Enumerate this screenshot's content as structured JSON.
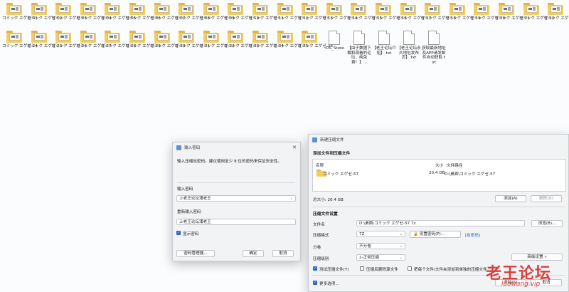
{
  "desktop": {
    "row1": [
      "コミック エゲゼ 01",
      "コミック エゲゼ 02",
      "コミック エゲゼ 03",
      "コミック エゲゼ 04",
      "コミック エゲゼ 05",
      "コミック エゲゼ 06",
      "コミック エゲゼ 07",
      "コミック エゲゼ 08",
      "コミック エゲゼ 09",
      "コミック エゲゼ 10",
      "コミック エゲゼ 11",
      "コミック エゲゼ 12",
      "コミック エゲゼ 13",
      "コミック エゲゼ 14",
      "コミック エゲゼ 15",
      "コミック エゲゼ 16",
      "コミック エゲゼ 17",
      "コミック エゲゼ 18",
      "コミック エゲゼ 19",
      "コミック エゲゼ 20",
      "コミック エゲゼ 21",
      "コミック エゲゼ 22",
      "コミック エゲゼ 23"
    ],
    "row2_folders": [
      "コミック エゲゼ 24",
      "コミック エゲゼ 25",
      "コミック エゲゼ 26",
      "コミック エゲゼ 27",
      "コミック エゲゼ 28",
      "コミック エゲゼ 29",
      "コミック エゲゼ 30",
      "コミック エゲゼ 31",
      "コミック エゲゼ 32",
      "コミック エゲゼ 33",
      "コミック エゲゼ 34",
      "コミック エゲゼ 35",
      "コミック エゲゼ 36"
    ],
    "row2_files": [
      ".DS_Store",
      "【由于数据下载和观看的论坛，纯免费！】...",
      "【老王论坛介绍】.txt",
      "【老王论坛永久地址发布页】.txt",
      "获取最新地址及APP请发邮件自动获取.txt"
    ]
  },
  "password_dialog": {
    "title": "输入密码",
    "hint": "输入压缩包密码。建议使用至少 8 位的密码来保证安全性。",
    "label_password": "输入密码",
    "password_value": "上老王论坛涌老王",
    "label_confirm": "重新输入密码",
    "confirm_value": "上老王论坛涌老王",
    "show_password": "显示密码",
    "btn_manager": "密码管理器...",
    "btn_ok": "确定",
    "btn_cancel": "取消",
    "close": "✕"
  },
  "archive_dialog": {
    "title": "新建压缩文件",
    "section_add": "添加文件到压缩文件",
    "col_name": "名称",
    "col_size": "大小",
    "col_path": "文件路径",
    "row_name": "コミック エゲゼ-57",
    "row_size": "20.4 GB",
    "row_path": "D:\\桌面\\コミック エゲゼ-57",
    "total": "总大小: 20.4 GB",
    "btn_add": "添加(A)",
    "btn_delete": "删除(D)",
    "section_settings": "压缩文件设置",
    "label_filename": "文件名",
    "filename_value": "D:\\桌面\\コミック エゲゼ-57.7z",
    "btn_browse": "浏览(B)...",
    "label_format": "压缩格式",
    "format_value": "7Z",
    "btn_set_password": "设置密码(P)...",
    "password_tag": "[有密码]",
    "label_volume": "分卷",
    "volume_value": "不分卷",
    "label_level": "压缩级别",
    "level_value": "2-正常压缩",
    "btn_advanced": "高级设置 »",
    "opt_test": "测试压缩文件(T)",
    "opt_delete": "压缩后删除源文件",
    "opt_each": "把每个文件/文件夹添加到单独的压缩文件",
    "more_options": "更多选项...",
    "btn_start": "开始(S)",
    "btn_cancel": "取消"
  },
  "watermark": {
    "main": "老王论坛",
    "url": "laowang.vip"
  }
}
